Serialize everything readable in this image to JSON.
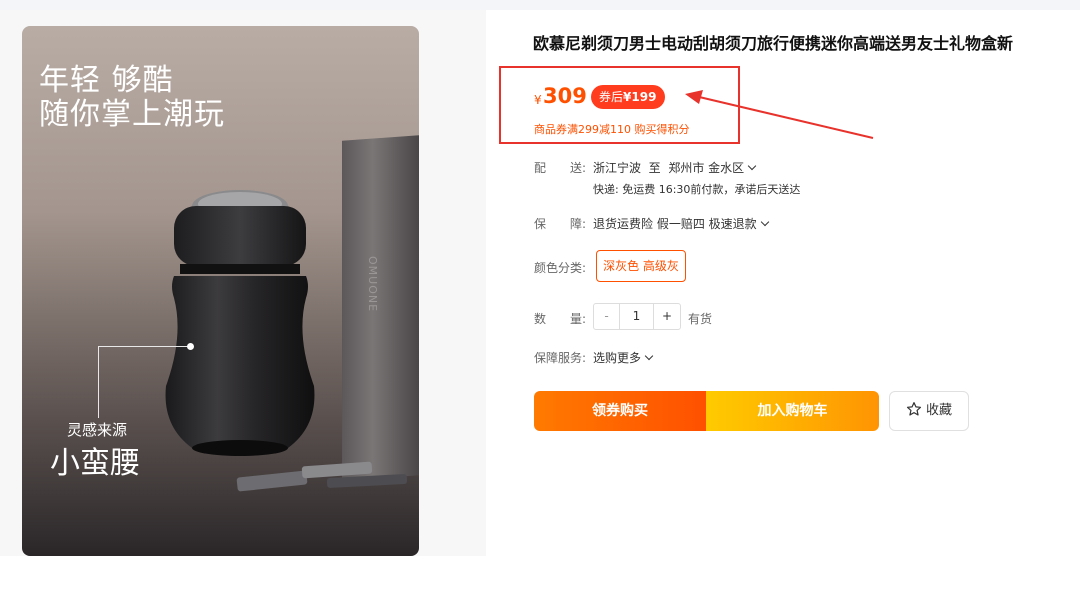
{
  "product": {
    "title": "欧慕尼剃须刀男士电动刮胡须刀旅行便携迷你高端送男友士礼物盒新",
    "image": {
      "slogan_line1": "年轻 够酷",
      "slogan_line2": "随你掌上潮玩",
      "box_brand": "OMUONE",
      "caption_small": "灵感来源",
      "caption_big": "小蛮腰"
    }
  },
  "price": {
    "currency": "¥",
    "amount": "309",
    "coupon_prefix": "券后",
    "coupon_price": "¥199",
    "coupon_note": "商品券满299减110 购买得积分"
  },
  "delivery": {
    "label": "配　　送:",
    "from": "浙江宁波",
    "to_word": "至",
    "to": "郑州市 金水区",
    "detail": "快递: 免运费 16:30前付款，承诺后天送达"
  },
  "guarantee": {
    "label": "保　　障:",
    "text": "退货运费险 假一赔四 极速退款"
  },
  "color": {
    "label": "颜色分类:",
    "selected": "深灰色 高级灰"
  },
  "quantity": {
    "label": "数　　量:",
    "minus": "-",
    "value": "1",
    "plus": "+",
    "stock": "有货"
  },
  "service": {
    "label": "保障服务:",
    "text": "选购更多"
  },
  "actions": {
    "buy": "领券购买",
    "cart": "加入购物车",
    "favorite": "收藏"
  },
  "colors": {
    "accent": "#ff5000",
    "annotation_red": "#e8322c",
    "coupon_pill": "#ff3d1e"
  },
  "icons": {
    "favorite": "star-outline-icon",
    "dropdown": "chevron-down-icon"
  }
}
